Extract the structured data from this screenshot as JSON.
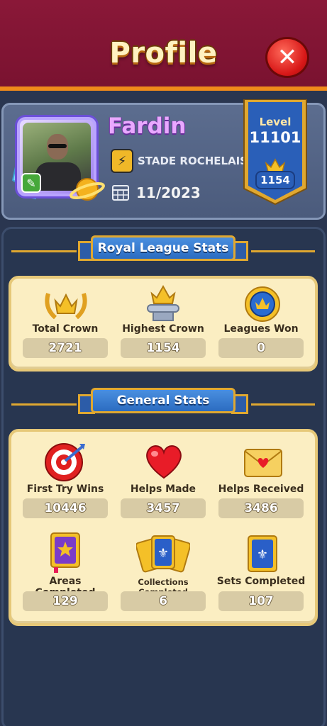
{
  "header": {
    "title": "Profile",
    "close_icon": "close-icon"
  },
  "player": {
    "name": "Fardin",
    "team": "STADE ROCHELAIS",
    "join_date": "11/2023",
    "edit_icon": "edit-icon",
    "team_icon": "lightning-badge-icon",
    "date_icon": "calendar-icon"
  },
  "level": {
    "label": "Level",
    "value": "11101",
    "crowns": "1154",
    "crown_icon": "crown-icon"
  },
  "royal_league": {
    "title": "Royal League Stats",
    "items": [
      {
        "label": "Total Crown",
        "value": "2721",
        "icon": "laurel-crown-icon"
      },
      {
        "label": "Highest Crown",
        "value": "1154",
        "icon": "pedestal-crown-icon"
      },
      {
        "label": "Leagues Won",
        "value": "0",
        "icon": "medal-crown-icon"
      }
    ]
  },
  "general": {
    "title": "General Stats",
    "items": [
      {
        "label": "First Try Wins",
        "value": "10446",
        "icon": "target-icon"
      },
      {
        "label": "Helps Made",
        "value": "3457",
        "icon": "heart-icon"
      },
      {
        "label": "Helps Received",
        "value": "3486",
        "icon": "envelope-heart-icon"
      },
      {
        "label": "Areas Completed",
        "value": "129",
        "icon": "star-book-icon"
      },
      {
        "label": "Collections Completed",
        "value": "6",
        "icon": "cards-fan-icon"
      },
      {
        "label": "Sets Completed",
        "value": "107",
        "icon": "card-icon"
      }
    ]
  },
  "colors": {
    "header": "#7a1230",
    "accent": "#f08a1a",
    "panel": "#283650",
    "card": "#fbeec2",
    "ribbon": "#2c6cc0"
  }
}
